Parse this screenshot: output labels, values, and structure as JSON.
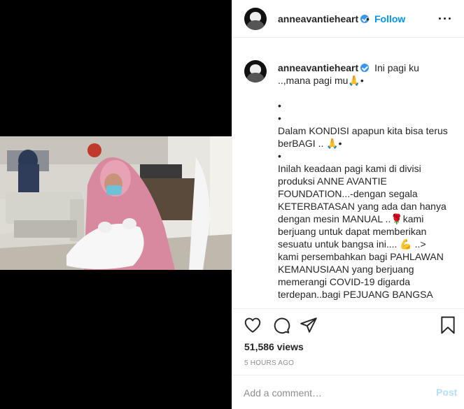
{
  "post": {
    "username": "anneavantieheart",
    "verified": true,
    "follow_label": "Follow",
    "separator": "•"
  },
  "media": {
    "type": "video",
    "description_icon": "video-frame"
  },
  "caption": {
    "lines": [
      "Ini pagi ku ..,mana pagi mu🙏•",
      "•",
      "•",
      "Dalam KONDISI apapun kita bisa terus berBAGI .. 🙏•",
      "•",
      "Inilah keadaan pagi kami di divisi produksi ANNE AVANTIE FOUNDATION...-dengan segala KETERBATASAN yang ada dan hanya dengan mesin MANUAL ..🌹kami berjuang untuk dapat memberikan sesuatu untuk bangsa ini.... 💪 ..>",
      "kami persembahkan bagi PAHLAWAN KEMANUSIAAN yang berjuang memerangi COVID-19 digarda terdepan..bagi PEJUANG BANGSA"
    ]
  },
  "stats": {
    "views": "51,586 views",
    "timestamp": "5 HOURS AGO"
  },
  "comment_box": {
    "placeholder": "Add a comment…",
    "post_label": "Post"
  },
  "icons": {
    "like": "heart-icon",
    "comment": "comment-icon",
    "share": "share-icon",
    "save": "bookmark-icon",
    "more": "more-options-icon"
  },
  "colors": {
    "accent": "#0095f6",
    "verified": "#3897f0",
    "text": "#262626",
    "muted": "#8e8e8e",
    "post_disabled": "#b2dffc",
    "border": "#efefef"
  }
}
